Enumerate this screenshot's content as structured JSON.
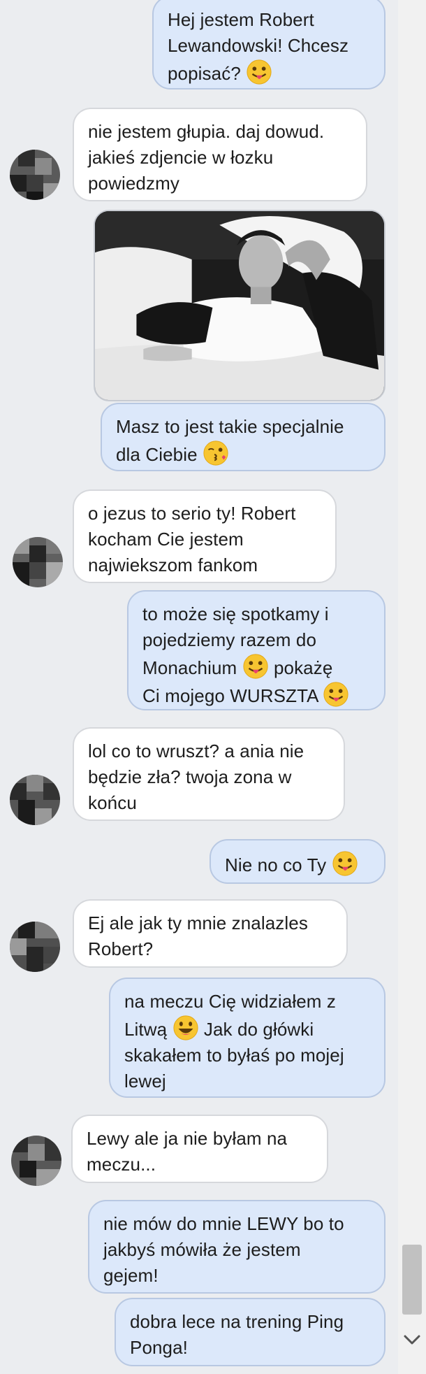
{
  "messages": [
    {
      "lines": [
        "Hej jestem Robert",
        "Lewandowski! Chcesz",
        "popisać?"
      ],
      "emoji": "tongue"
    },
    {
      "lines": [
        "nie jestem głupia. daj dowud.",
        "jakieś zdjencie w łozku",
        "powiedzmy"
      ]
    },
    {
      "lines": [
        "Masz to jest takie specjalnie",
        "dla Ciebie"
      ],
      "emoji": "kiss"
    },
    {
      "lines": [
        "o jezus to serio ty! Robert",
        "kocham Cie jestem",
        "najwiekszom fankom"
      ]
    },
    {
      "lines": [
        "to może się spotkamy i",
        "pojedziemy razem do",
        "Monachium",
        "pokażę",
        "Ci mojego WURSZTA"
      ],
      "emoji": "tongue"
    },
    {
      "lines": [
        "lol co to wruszt? a ania nie",
        "będzie zła? twoja zona w",
        "końcu"
      ]
    },
    {
      "lines": [
        "Nie no co Ty"
      ],
      "emoji": "tongue"
    },
    {
      "lines": [
        "Ej ale jak ty mnie znalazles",
        "Robert?"
      ]
    },
    {
      "lines": [
        "na meczu Cię widziałem z",
        "Litwą",
        "Jak do główki",
        "skakałem to byłaś po mojej",
        "lewej"
      ],
      "emoji": "grin"
    },
    {
      "lines": [
        "Lewy ale ja nie byłam na",
        "meczu..."
      ]
    },
    {
      "lines": [
        "nie mów do mnie LEWY bo to",
        "jakbyś mówiła że jestem",
        "gejem!"
      ]
    },
    {
      "lines": [
        "dobra lece na trening Ping",
        "Ponga!"
      ]
    }
  ],
  "photo": {
    "description_icon": "image-attachment"
  },
  "colors": {
    "outgoing_bubble": "#dce8fa",
    "incoming_bubble": "#ffffff",
    "background": "#ebedf0",
    "emoji_yellow": "#f7c531"
  },
  "icons": {
    "scroll_down": "chevron-down-icon"
  }
}
